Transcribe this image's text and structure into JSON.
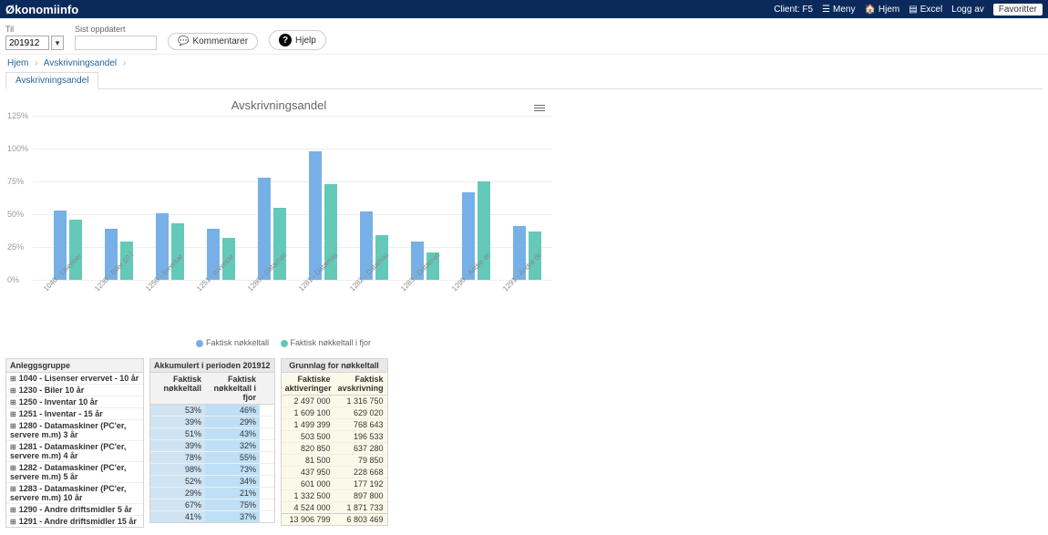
{
  "brand": "Økonomiinfo",
  "topbar": {
    "client": "Client: F5",
    "menu": "Meny",
    "home": "Hjem",
    "excel": "Excel",
    "logoff": "Logg av",
    "favorite": "Favoritter"
  },
  "controls": {
    "til_label": "Til",
    "period_value": "201912",
    "updated_label": "Sist oppdatert",
    "comment_btn": "Kommentarer",
    "help_btn": "Hjelp"
  },
  "breadcrumb": {
    "home": "Hjem",
    "page": "Avskrivningsandel"
  },
  "tab": "Avskrivningsandel",
  "chart_data": {
    "type": "bar",
    "title": "Avskrivningsandel",
    "ylabel": "",
    "ylim": [
      0,
      125
    ],
    "yticks": [
      0,
      25,
      50,
      75,
      100,
      125
    ],
    "ytick_labels": [
      "0%",
      "25%",
      "50%",
      "75%",
      "100%",
      "125%"
    ],
    "categories": [
      "1040 - Lisenser ervervet - 1...",
      "1230 - Biler 10 år",
      "1250 - Inventar - 10 år",
      "1251 - Inventar - 15 år",
      "1280 - Datamaskiner (PC'er...",
      "1281 - Datamaskiner (PC'er...",
      "1282 - Datamaskiner (PC'er...",
      "1283 - Datamaskiner (PC'er...",
      "1290 - Andre driftsmidler 5 år",
      "1291 - Andre driftsmidler 1..."
    ],
    "series": [
      {
        "name": "Faktisk nøkkeltall",
        "color": "#77b0e6",
        "values": [
          53,
          39,
          51,
          39,
          78,
          98,
          52,
          29,
          67,
          41
        ]
      },
      {
        "name": "Faktisk nøkkeltall i fjor",
        "color": "#64c9b9",
        "values": [
          46,
          29,
          43,
          32,
          55,
          73,
          34,
          21,
          75,
          37
        ]
      }
    ]
  },
  "table": {
    "group_header": "Anleggsgruppe",
    "akkum_header": "Akkumulert i perioden 201912",
    "akkum_cols": [
      "Faktisk nøkkeltall",
      "Faktisk nøkkeltall i fjor"
    ],
    "grunn_header": "Grunnlag for nøkkeltall",
    "grunn_cols": [
      "Faktiske aktiveringer",
      "Faktisk avskrivning"
    ],
    "rows": [
      {
        "name": "1040 - Lisenser ervervet - 10 år",
        "a": "53%",
        "b": "46%",
        "c": "2 497 000",
        "d": "1 316 750"
      },
      {
        "name": "1230 - Biler 10 år",
        "a": "39%",
        "b": "29%",
        "c": "1 609 100",
        "d": "629 020"
      },
      {
        "name": "1250 - Inventar 10 år",
        "a": "51%",
        "b": "43%",
        "c": "1 499 399",
        "d": "768 643"
      },
      {
        "name": "1251 - Inventar - 15 år",
        "a": "39%",
        "b": "32%",
        "c": "503 500",
        "d": "196 533"
      },
      {
        "name": "1280 - Datamaskiner (PC'er, servere m.m) 3 år",
        "a": "78%",
        "b": "55%",
        "c": "820 850",
        "d": "637 280"
      },
      {
        "name": "1281 - Datamaskiner (PC'er, servere m.m) 4 år",
        "a": "98%",
        "b": "73%",
        "c": "81 500",
        "d": "79 850"
      },
      {
        "name": "1282 - Datamaskiner (PC'er, servere m.m) 5 år",
        "a": "52%",
        "b": "34%",
        "c": "437 950",
        "d": "228 668"
      },
      {
        "name": "1283 - Datamaskiner (PC'er, servere m.m) 10 år",
        "a": "29%",
        "b": "21%",
        "c": "601 000",
        "d": "177 192"
      },
      {
        "name": "1290 - Andre driftsmidler 5 år",
        "a": "67%",
        "b": "75%",
        "c": "1 332 500",
        "d": "897 800"
      },
      {
        "name": "1291 - Andre driftsmidler 15 år",
        "a": "41%",
        "b": "37%",
        "c": "4 524 000",
        "d": "1 871 733"
      }
    ],
    "totals": {
      "c": "13 906 799",
      "d": "6 803 469"
    }
  }
}
